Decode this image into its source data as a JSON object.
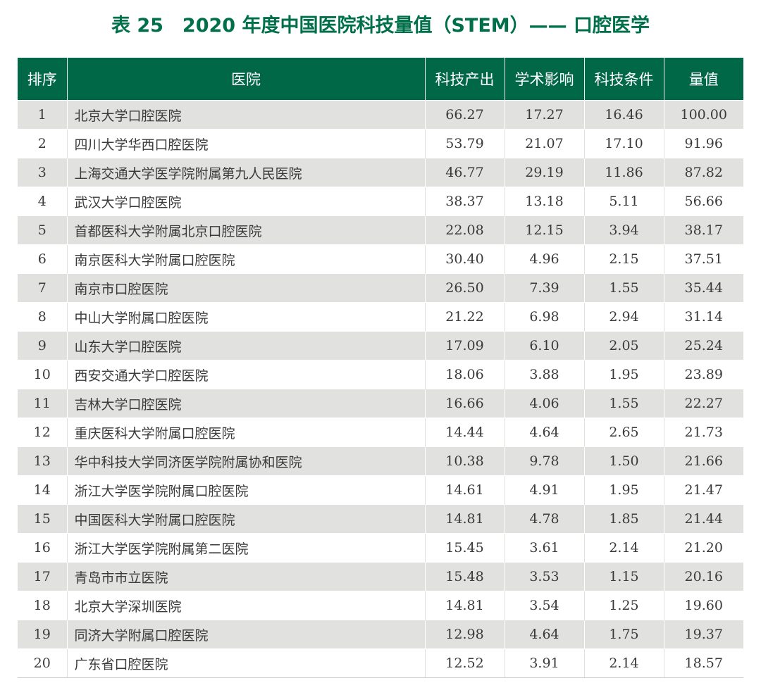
{
  "title": "表 25　2020 年度中国医院科技量值（STEM）—— 口腔医学",
  "table": {
    "headers": [
      "排序",
      "医院",
      "科技产出",
      "学术影响",
      "科技条件",
      "量值"
    ],
    "rows": [
      [
        "1",
        "北京大学口腔医院",
        "66.27",
        "17.27",
        "16.46",
        "100.00"
      ],
      [
        "2",
        "四川大学华西口腔医院",
        "53.79",
        "21.07",
        "17.10",
        "91.96"
      ],
      [
        "3",
        "上海交通大学医学院附属第九人民医院",
        "46.77",
        "29.19",
        "11.86",
        "87.82"
      ],
      [
        "4",
        "武汉大学口腔医院",
        "38.37",
        "13.18",
        "5.11",
        "56.66"
      ],
      [
        "5",
        "首都医科大学附属北京口腔医院",
        "22.08",
        "12.15",
        "3.94",
        "38.17"
      ],
      [
        "6",
        "南京医科大学附属口腔医院",
        "30.40",
        "4.96",
        "2.15",
        "37.51"
      ],
      [
        "7",
        "南京市口腔医院",
        "26.50",
        "7.39",
        "1.55",
        "35.44"
      ],
      [
        "8",
        "中山大学附属口腔医院",
        "21.22",
        "6.98",
        "2.94",
        "31.14"
      ],
      [
        "9",
        "山东大学口腔医院",
        "17.09",
        "6.10",
        "2.05",
        "25.24"
      ],
      [
        "10",
        "西安交通大学口腔医院",
        "18.06",
        "3.88",
        "1.95",
        "23.89"
      ],
      [
        "11",
        "吉林大学口腔医院",
        "16.66",
        "4.06",
        "1.55",
        "22.27"
      ],
      [
        "12",
        "重庆医科大学附属口腔医院",
        "14.44",
        "4.64",
        "2.65",
        "21.73"
      ],
      [
        "13",
        "华中科技大学同济医学院附属协和医院",
        "10.38",
        "9.78",
        "1.50",
        "21.66"
      ],
      [
        "14",
        "浙江大学医学院附属口腔医院",
        "14.61",
        "4.91",
        "1.95",
        "21.47"
      ],
      [
        "15",
        "中国医科大学附属口腔医院",
        "14.81",
        "4.78",
        "1.85",
        "21.44"
      ],
      [
        "16",
        "浙江大学医学院附属第二医院",
        "15.45",
        "3.61",
        "2.14",
        "21.20"
      ],
      [
        "17",
        "青岛市市立医院",
        "15.48",
        "3.53",
        "1.15",
        "20.16"
      ],
      [
        "18",
        "北京大学深圳医院",
        "14.81",
        "3.54",
        "1.25",
        "19.60"
      ],
      [
        "19",
        "同济大学附属口腔医院",
        "12.98",
        "4.64",
        "1.75",
        "19.37"
      ],
      [
        "20",
        "广东省口腔医院",
        "12.52",
        "3.91",
        "2.14",
        "18.57"
      ]
    ]
  },
  "colors": {
    "title": "#00704a",
    "header_bg": "#006747",
    "row_shade": "#e1e2e0"
  }
}
